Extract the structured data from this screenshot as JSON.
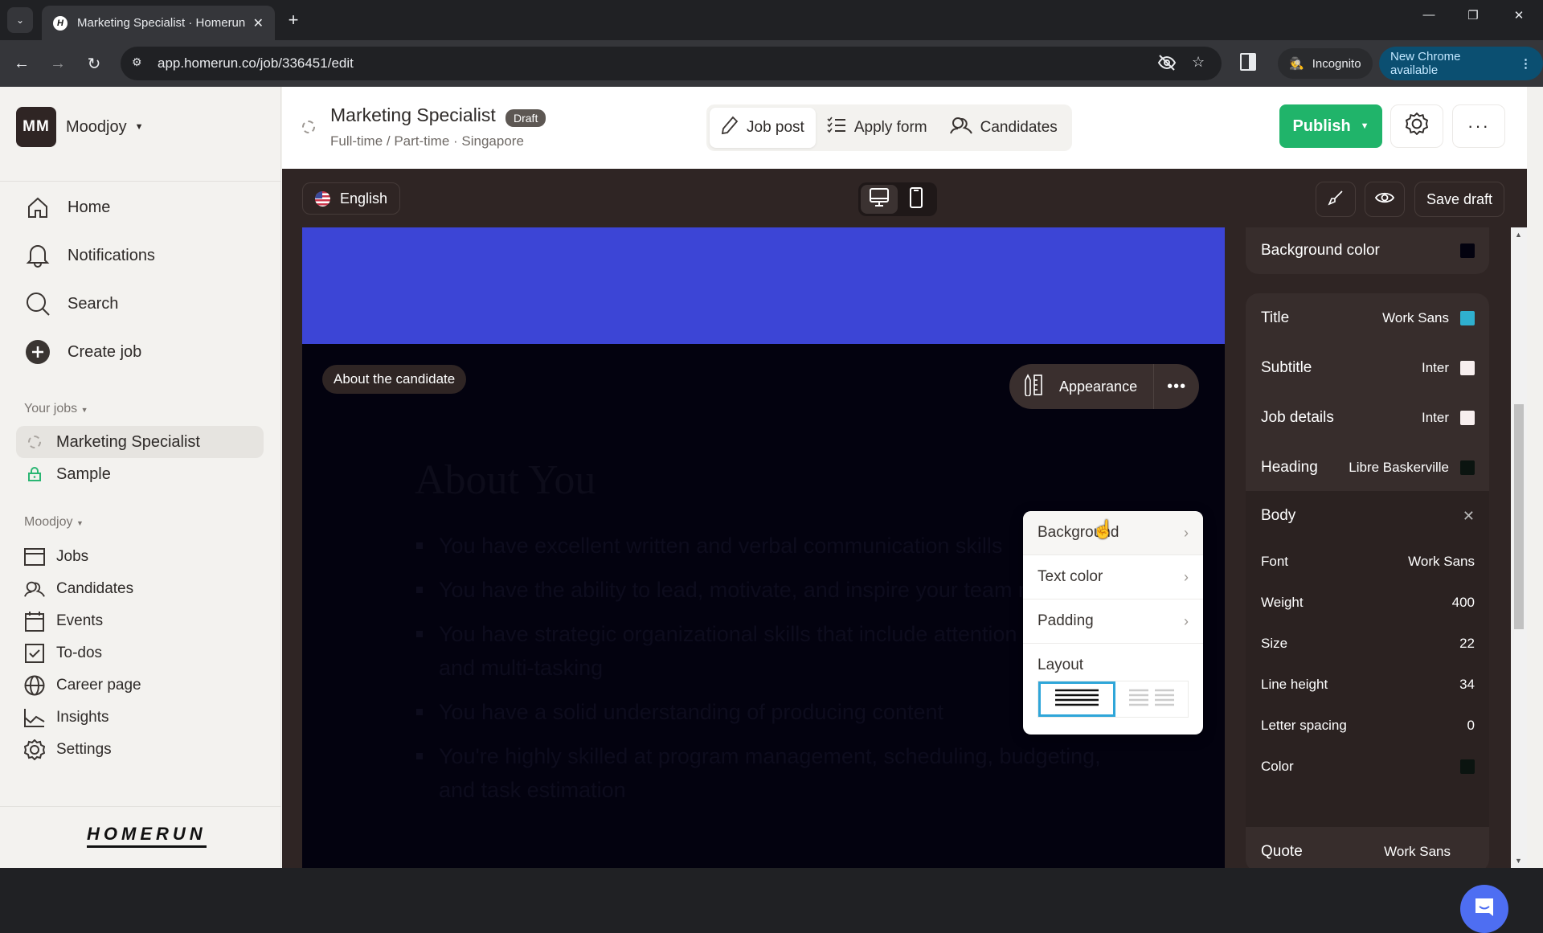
{
  "browser": {
    "tab_title": "Marketing Specialist · Homerun",
    "favicon_letter": "H",
    "url": "app.homerun.co/job/336451/edit",
    "incognito_label": "Incognito",
    "update_label": "New Chrome available"
  },
  "sidebar": {
    "org_initials": "MM",
    "org_name": "Moodjoy",
    "main_nav": [
      {
        "label": "Home",
        "icon": "home-icon"
      },
      {
        "label": "Notifications",
        "icon": "bell-icon"
      },
      {
        "label": "Search",
        "icon": "search-icon"
      },
      {
        "label": "Create job",
        "icon": "plus-circle-icon"
      }
    ],
    "jobs_section_label": "Your jobs",
    "jobs": [
      {
        "label": "Marketing Specialist",
        "icon": "draft-status-icon",
        "active": true
      },
      {
        "label": "Sample",
        "icon": "lock-icon",
        "active": false
      }
    ],
    "org_section_label": "Moodjoy",
    "org_nav": [
      {
        "label": "Jobs",
        "icon": "jobs-icon"
      },
      {
        "label": "Candidates",
        "icon": "users-icon"
      },
      {
        "label": "Events",
        "icon": "calendar-icon"
      },
      {
        "label": "To-dos",
        "icon": "checkbox-icon"
      },
      {
        "label": "Career page",
        "icon": "globe-icon"
      },
      {
        "label": "Insights",
        "icon": "chart-icon"
      },
      {
        "label": "Settings",
        "icon": "gear-icon"
      }
    ],
    "logo_text": "HOMERUN"
  },
  "header": {
    "job_title": "Marketing Specialist",
    "status_badge": "Draft",
    "job_subtitle": "Full-time / Part-time · Singapore",
    "tabs": [
      {
        "label": "Job post",
        "icon": "pencil-icon",
        "active": true
      },
      {
        "label": "Apply form",
        "icon": "checklist-icon",
        "active": false
      },
      {
        "label": "Candidates",
        "icon": "users-icon",
        "active": false
      }
    ],
    "publish_label": "Publish",
    "publish_color": "#20b46a"
  },
  "editor_bar": {
    "language": "English",
    "device_modes": [
      "desktop",
      "mobile"
    ],
    "active_device": "desktop",
    "save_draft_label": "Save draft"
  },
  "canvas": {
    "hero_color": "#3c45d6",
    "section_bg_color": "#03020f",
    "section_tag": "About the candidate",
    "appearance_label": "Appearance",
    "heading": "About You",
    "bullets": [
      "You have excellent written and verbal communication skills",
      "You have the ability to lead, motivate, and inspire your team members",
      "You have strategic organizational skills that include attention to detail and multi-tasking",
      "You have a solid understanding of producing content",
      "You're highly skilled at program management, scheduling, budgeting, and task estimation"
    ]
  },
  "appearance_menu": {
    "items": [
      {
        "label": "Background"
      },
      {
        "label": "Text color"
      },
      {
        "label": "Padding"
      }
    ],
    "layout_label": "Layout",
    "layout_options": [
      "single-column",
      "two-column"
    ],
    "selected_layout": "single-column",
    "accent_color": "#2fa6d9"
  },
  "settings_panel": {
    "background_color_label": "Background color",
    "background_color": "#03020f",
    "typography": [
      {
        "label": "Title",
        "font": "Work Sans",
        "color": "#2fb0cf"
      },
      {
        "label": "Subtitle",
        "font": "Inter",
        "color": "#f7eeee"
      },
      {
        "label": "Job details",
        "font": "Inter",
        "color": "#f7eeee"
      },
      {
        "label": "Heading",
        "font": "Libre Baskerville",
        "color": "#0b1410"
      }
    ],
    "body": {
      "label": "Body",
      "props": [
        {
          "label": "Font",
          "value": "Work Sans"
        },
        {
          "label": "Weight",
          "value": "400"
        },
        {
          "label": "Size",
          "value": "22"
        },
        {
          "label": "Line height",
          "value": "34"
        },
        {
          "label": "Letter spacing",
          "value": "0"
        },
        {
          "label": "Color",
          "value": ""
        }
      ],
      "color": "#0b1410"
    },
    "quote": {
      "label": "Quote",
      "font": "Work Sans"
    }
  }
}
